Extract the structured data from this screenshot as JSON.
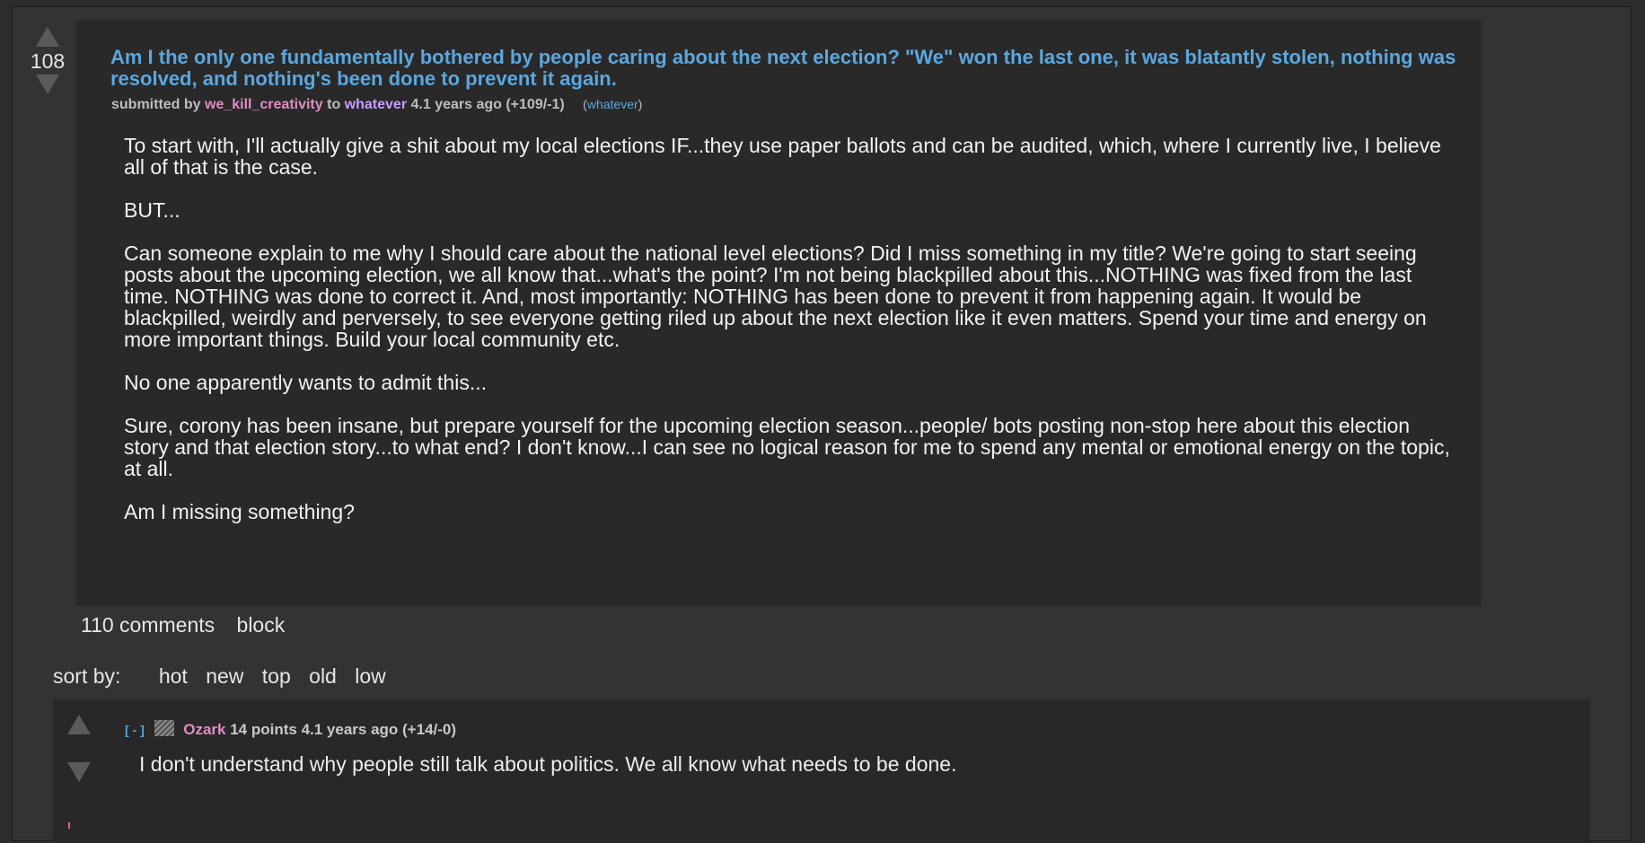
{
  "post": {
    "score": "108",
    "title": "Am I the only one fundamentally bothered by people caring about the next election? \"We\" won the last one, it was blatantly stolen, nothing was resolved, and nothing's been done to prevent it again.",
    "submitted_by_label": "submitted by",
    "author": "we_kill_creativity",
    "to_label": "to",
    "community": "whatever",
    "age_and_votes": "4.1 years ago (+109/-1)",
    "flair_open": "(",
    "flair_link": "whatever",
    "flair_close": ")",
    "body": [
      "To start with, I'll actually give a shit about my local elections IF...they use paper ballots and can be audited, which, where I currently live, I believe all of that is the case.",
      "BUT...",
      "Can someone explain to me why I should care about the national level elections? Did I miss something in my title? We're going to start seeing posts about the upcoming election, we all know that...what's the point? I'm not being blackpilled about this...NOTHING was fixed from the last time. NOTHING was done to correct it. And, most importantly: NOTHING has been done to prevent it from happening again. It would be blackpilled, weirdly and perversely, to see everyone getting riled up about the next election like it even matters. Spend your time and energy on more important things. Build your local community etc.",
      "No one apparently wants to admit this...",
      "Sure, corony has been insane, but prepare yourself for the upcoming election season...people/ bots posting non-stop here about this election story and that election story...to what end? I don't know...I can see no logical reason for me to spend any mental or emotional energy on the topic, at all.",
      "Am I missing something?"
    ],
    "actions": {
      "comments": "110 comments",
      "block": "block"
    }
  },
  "sort": {
    "label": "sort by:",
    "options": [
      "hot",
      "new",
      "top",
      "old",
      "low"
    ]
  },
  "comment": {
    "collapse": "[ - ]",
    "author": "Ozark",
    "points_and_age": "14 points 4.1 years ago (+14/-0)",
    "text": "I don't understand why people still talk about politics. We all know what needs to be done."
  },
  "colors": {
    "link_blue": "#5aa7df",
    "user_pink": "#e08cc2",
    "sub_purple": "#c79cff",
    "background": "#333333"
  }
}
